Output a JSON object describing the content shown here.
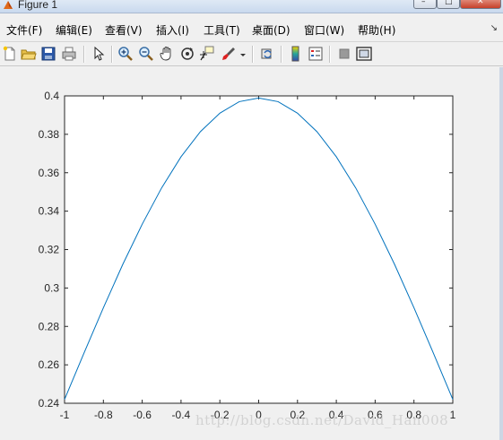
{
  "window": {
    "title": "Figure 1",
    "minimize_glyph": "–",
    "maximize_glyph": "□",
    "close_glyph": "✕"
  },
  "menu": {
    "items": [
      "文件(F)",
      "编辑(E)",
      "查看(V)",
      "插入(I)",
      "工具(T)",
      "桌面(D)",
      "窗口(W)",
      "帮助(H)"
    ],
    "overflow_glyph": "↘"
  },
  "toolbar": {
    "icons": [
      "new-figure-icon",
      "open-file-icon",
      "save-icon",
      "print-icon",
      "edit-plot-arrow-icon",
      "zoom-in-icon",
      "zoom-out-icon",
      "pan-hand-icon",
      "rotate-3d-icon",
      "data-cursor-icon",
      "brush-icon",
      "brush-dropdown-icon",
      "link-plot-icon",
      "insert-colorbar-icon",
      "insert-legend-icon",
      "hide-plot-tools-icon",
      "show-plot-tools-icon"
    ]
  },
  "chart_data": {
    "type": "line",
    "title": "",
    "xlabel": "",
    "ylabel": "",
    "xlim": [
      -1,
      1
    ],
    "ylim": [
      0.24,
      0.4
    ],
    "x_ticks": [
      "-1",
      "-0.8",
      "-0.6",
      "-0.4",
      "-0.2",
      "0",
      "0.2",
      "0.4",
      "0.6",
      "0.8",
      "1"
    ],
    "y_ticks": [
      "0.24",
      "0.26",
      "0.28",
      "0.3",
      "0.32",
      "0.34",
      "0.36",
      "0.38",
      "0.4"
    ],
    "grid": false,
    "series": [
      {
        "color": "#0072bd",
        "x": [
          -1,
          -0.9,
          -0.8,
          -0.7,
          -0.6,
          -0.5,
          -0.4,
          -0.3,
          -0.2,
          -0.1,
          0,
          0.1,
          0.2,
          0.3,
          0.4,
          0.5,
          0.6,
          0.7,
          0.8,
          0.9,
          1
        ],
        "y": [
          0.242,
          0.2661,
          0.2897,
          0.3123,
          0.3332,
          0.3521,
          0.3683,
          0.3814,
          0.391,
          0.397,
          0.3989,
          0.397,
          0.391,
          0.3814,
          0.3683,
          0.3521,
          0.3332,
          0.3123,
          0.2897,
          0.2661,
          0.242
        ]
      }
    ]
  },
  "watermark": "http://blog.csdn.net/David_Han008"
}
